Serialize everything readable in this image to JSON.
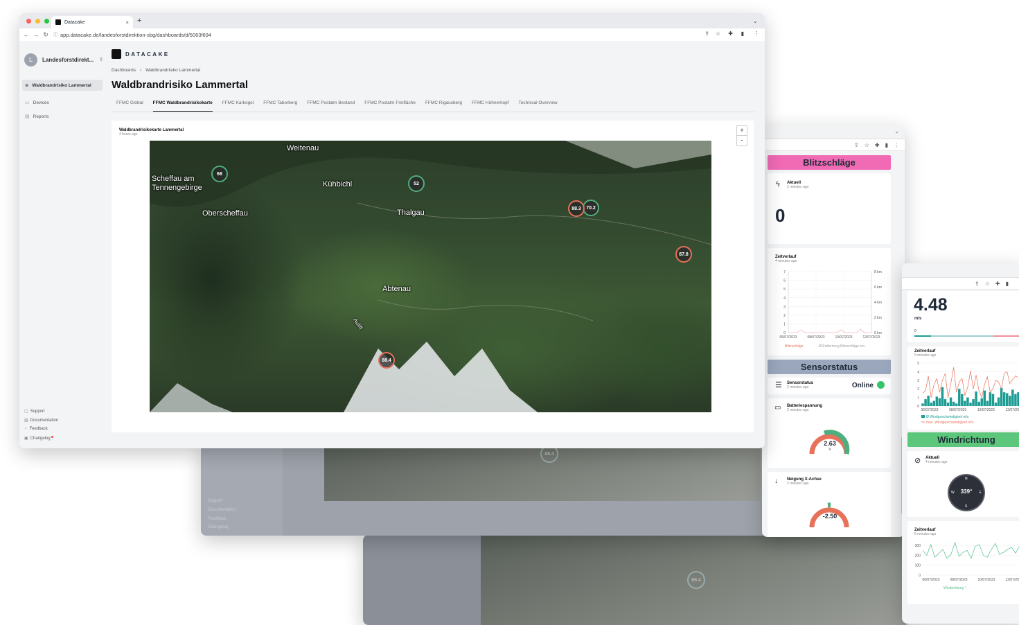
{
  "browser": {
    "tab_title": "Datacake",
    "url": "app.datacake.de/landesforstdirektion-sbg/dashboards/d/5063f694",
    "new_tab": "+"
  },
  "brand": {
    "name": "DATACAKE"
  },
  "workspace": {
    "avatar": "L",
    "name": "Landesforstdirekt..."
  },
  "sidebar": {
    "active_item": "Waldbrandrisiko Lammertal",
    "items": [
      {
        "label": "Devices"
      },
      {
        "label": "Reports"
      }
    ],
    "footer": [
      {
        "label": "Support"
      },
      {
        "label": "Documentation"
      },
      {
        "label": "Feedback"
      },
      {
        "label": "Changelog"
      }
    ]
  },
  "breadcrumb": {
    "root": "Dashboards",
    "sep": "›",
    "current": "Waldbrandrisiko Lammertal"
  },
  "page_title": "Waldbrandrisiko Lammertal",
  "tabs": [
    {
      "label": "FFMC Global",
      "active": false
    },
    {
      "label": "FFMC Waldbrandrisikokarte",
      "active": true
    },
    {
      "label": "FFMC Karkogel",
      "active": false
    },
    {
      "label": "FFMC Taborberg",
      "active": false
    },
    {
      "label": "FFMC Postalm Bestand",
      "active": false
    },
    {
      "label": "FFMC Postalm Freifläche",
      "active": false
    },
    {
      "label": "FFMC Rigausberg",
      "active": false
    },
    {
      "label": "FFMC Hühnerkopf",
      "active": false
    },
    {
      "label": "Technical Overview",
      "active": false
    }
  ],
  "map_widget": {
    "title": "Waldbrandrisikokarte Lammertal",
    "subtitle": "4 hours ago",
    "zoom_in": "+",
    "zoom_out": "-",
    "places": [
      "Weitenau",
      "Scheffau am\nTennengebirge",
      "Kühbichl",
      "Oberscheffau",
      "Thalgau",
      "Abtenau",
      "Aulift"
    ],
    "clusters": [
      {
        "value": "68",
        "status": "green"
      },
      {
        "value": "52",
        "status": "green"
      },
      {
        "value": "88.3",
        "status": "red"
      },
      {
        "value": "70.2",
        "status": "green"
      },
      {
        "value": "87.8",
        "status": "red"
      },
      {
        "value": "88.4",
        "status": "red"
      }
    ]
  },
  "background_windows": {
    "cluster_a": "88.4",
    "cluster_b": "88.4",
    "footer": [
      "Support",
      "Documentation",
      "Feedback",
      "Changelog"
    ]
  },
  "panel_blitz": {
    "header": "Blitzschläge",
    "header_color": "#f06ab4",
    "current": {
      "title": "Aktuell",
      "time": "2 minutes ago",
      "value": "0"
    },
    "history": {
      "title": "Zeitverlauf",
      "time": "4 minutes ago",
      "y_left": [
        "7",
        "6",
        "5",
        "4",
        "3",
        "2",
        "1",
        "0"
      ],
      "y_right": [
        "8 km",
        "6 km",
        "4 km",
        "2 km",
        "0 km"
      ],
      "x": [
        "06/07/2023",
        "08/07/2023",
        "10/07/2023",
        "12/07/2023"
      ],
      "legend": [
        "Blitzschläge",
        "Ø Entfernung Blitzschläge km"
      ]
    }
  },
  "panel_sensor": {
    "header": "Sensorstatus",
    "header_color": "#9ba7bd",
    "status": {
      "title": "Sensorstatus",
      "time": "2 minutes ago",
      "value": "Online"
    },
    "battery": {
      "title": "Batteriespannung",
      "time": "2 minutes ago",
      "value": "2.63",
      "unit": "V",
      "level": 0.7
    },
    "tilt": {
      "title": "Neigung X-Achse",
      "time": "2 minutes ago",
      "value": "-2.50",
      "level": 0.45
    }
  },
  "panel_wind": {
    "speed": {
      "value": "4.48",
      "unit": "m/s",
      "min": "0",
      "max": "30"
    },
    "history": {
      "title": "Zeitverlauf",
      "time": "5 minutes ago",
      "y": [
        "5",
        "4",
        "3",
        "2",
        "1",
        "0"
      ],
      "x": [
        "06/07/2023",
        "08/07/2023",
        "10/07/2023",
        "12/07/2023"
      ],
      "legend": [
        "Ø Windgeschwindigkeit m/s",
        "max. Windgeschwindigkeit m/s"
      ]
    },
    "direction_header": "Windrichtung",
    "direction_header_color": "#5cc77a",
    "direction": {
      "title": "Aktuell",
      "time": "4 minutes ago",
      "value": "339°",
      "n": "N",
      "s": "S",
      "e": "E",
      "w": "W"
    },
    "direction_history": {
      "title": "Zeitverlauf",
      "time": "5 minutes ago",
      "y": [
        "300",
        "200",
        "100",
        "0"
      ],
      "x": [
        "06/07/2023",
        "08/07/2023",
        "10/07/2023",
        "12/07/2023"
      ],
      "legend": "Windrichtung °"
    }
  }
}
